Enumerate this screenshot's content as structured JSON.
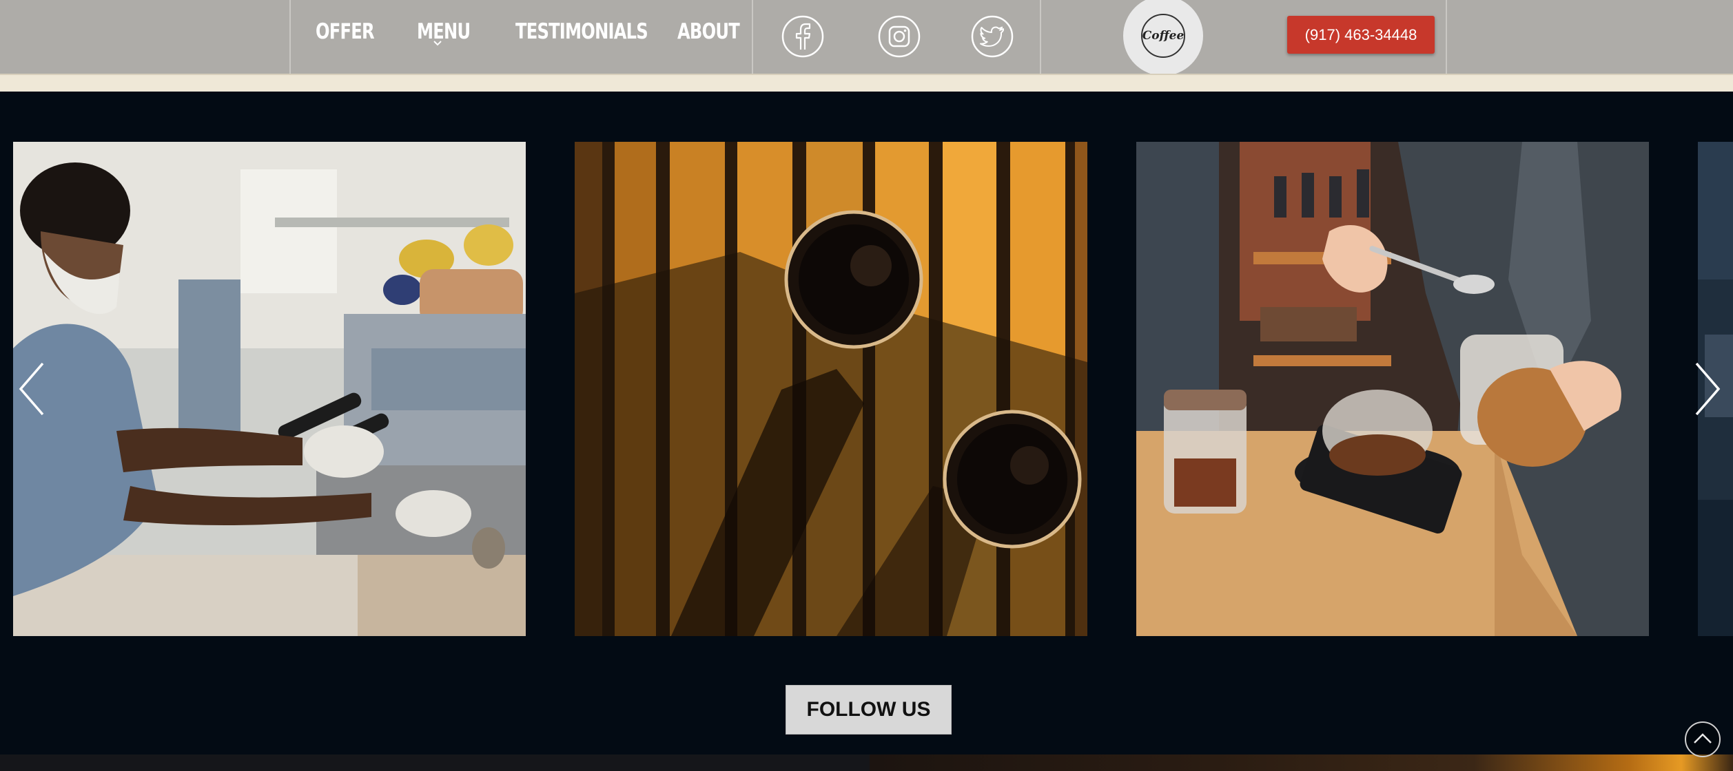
{
  "nav": {
    "items": [
      {
        "label": "OFFER"
      },
      {
        "label": "MENU"
      },
      {
        "label": "TESTIMONIALS"
      },
      {
        "label": "ABOUT"
      }
    ],
    "social_icons": [
      "facebook-icon",
      "instagram-icon",
      "twitter-icon"
    ],
    "logo_text": "Coffee",
    "phone_label": "(917) 463-34448"
  },
  "gallery": {
    "photos": [
      {
        "description_icon": "barista-espresso-machine-photo"
      },
      {
        "description_icon": "coffee-cups-on-wood-photo"
      },
      {
        "description_icon": "barista-scale-jars-photo"
      },
      {
        "description_icon": "partial-next-photo"
      }
    ],
    "prev_icon": "chevron-left-icon",
    "next_icon": "chevron-right-icon"
  },
  "follow": {
    "label": "FOLLOW US"
  },
  "scroll_top_icon": "chevron-up-circle-icon",
  "colors": {
    "header_bg": "#aeaca8",
    "cream_band": "#efe8d7",
    "section_bg": "#030b14",
    "phone_button": "#c7382b",
    "follow_button": "#d8d8d8"
  }
}
